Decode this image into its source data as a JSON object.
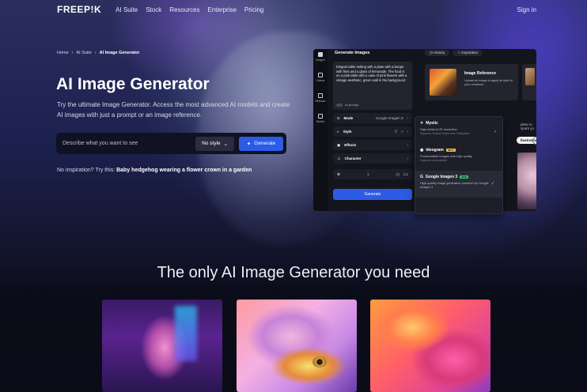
{
  "nav": {
    "logo": "FREEP!K",
    "links": [
      "AI Suite",
      "Stock",
      "Resources",
      "Enterprise",
      "Pricing"
    ],
    "sign_in": "Sign in"
  },
  "breadcrumb": [
    "Home",
    "AI Suite",
    "AI Image Generator"
  ],
  "hero": {
    "title": "AI Image Generator",
    "description": "Try the ultimate Image Generator. Access the most advanced AI models and create AI images with just a prompt or an image reference.",
    "prompt_placeholder": "Describe what you want to see",
    "style_label": "No style",
    "generate_label": "Generate",
    "inspiration_prefix": "No inspiration? Try this:",
    "inspiration_example": "Baby hedgehog wearing a flower crown in a garden"
  },
  "preview": {
    "rail": [
      "Images",
      "Videos",
      "Retouch",
      "Sketch"
    ],
    "panel_title": "Generate Images",
    "prompt_text": "Elegant table setting with a plate with a burger with fries and a glass of lemonade. The food is on a pink table with a vase of pink flowers with a vintage aesthetic, green wall in the background",
    "ai_prompt": "AI prompt",
    "mode_label": "Mode",
    "mode_value": "Google Imagen 3",
    "options": [
      "Style",
      "Effects",
      "Character"
    ],
    "steppers": [
      "1",
      "1:1"
    ],
    "generate_label": "Generate",
    "tabs": [
      "History",
      "Inspiration"
    ],
    "reference_title": "Image Reference",
    "reference_desc": "Upload an image to apply its style to your creations.",
    "ideas_text": "plete to spark yo",
    "chip_label": "llustration"
  },
  "dropdown": {
    "items": [
      {
        "name": "Mystic",
        "badge": "",
        "desc": "High-detail at 2K resolution",
        "sub": "Supports Custom Styles and Characters"
      },
      {
        "name": "Ideogram",
        "badge": "BETA",
        "desc": "Photorealistic images with high quality",
        "sub": "Supports color palette"
      },
      {
        "name": "Google Imagen 3",
        "badge": "NEW",
        "desc": "High-quality image generation powered by Google Imagen 3",
        "sub": ""
      }
    ]
  },
  "section": {
    "title": "The only AI Image Generator you need"
  },
  "colors": {
    "accent": "#2c5be6",
    "background": "#0c0e1f"
  }
}
